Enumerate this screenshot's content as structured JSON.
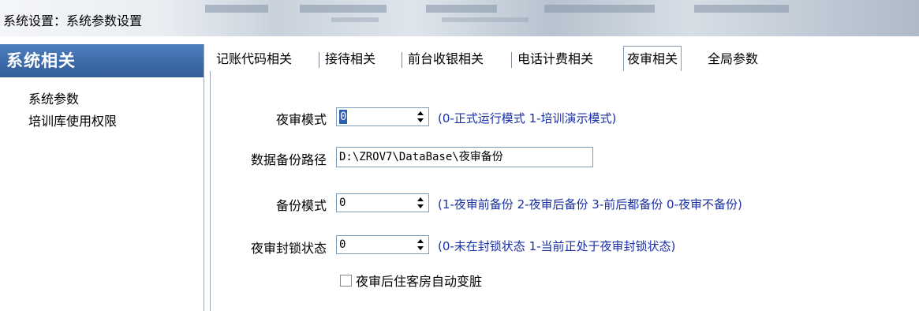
{
  "window": {
    "title": "系统设置：系统参数设置"
  },
  "sidebar": {
    "header": "系统相关",
    "items": [
      {
        "label": "系统参数"
      },
      {
        "label": "培训库使用权限"
      }
    ]
  },
  "tabs": [
    {
      "label": "记账代码相关"
    },
    {
      "label": "接待相关"
    },
    {
      "label": "前台收银相关"
    },
    {
      "label": "电话计费相关"
    },
    {
      "label": "夜审相关",
      "active": true
    },
    {
      "label": "全局参数"
    }
  ],
  "form": {
    "audit_mode": {
      "label": "夜审模式",
      "value": "0",
      "hint": "(0-正式运行模式 1-培训演示模式)"
    },
    "backup_path": {
      "label": "数据备份路径",
      "value": "D:\\ZROV7\\DataBase\\夜审备份"
    },
    "backup_mode": {
      "label": "备份模式",
      "value": "0",
      "hint": "(1-夜审前备份 2-夜审后备份 3-前后都备份 0-夜审不备份)"
    },
    "lock_state": {
      "label": "夜审封锁状态",
      "value": "0",
      "hint": "(0-未在封锁状态 1-当前正处于夜审封锁状态)"
    },
    "auto_dirty": {
      "label": "夜审后住客房自动变脏",
      "checked": false
    }
  }
}
